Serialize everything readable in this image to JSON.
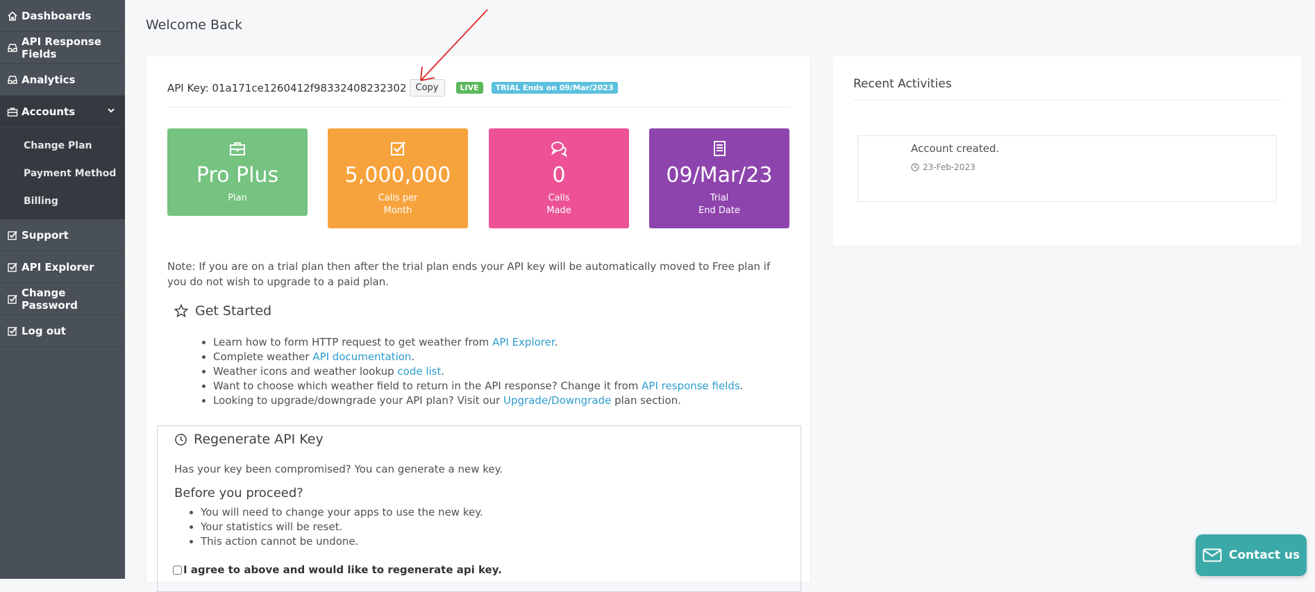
{
  "sidebar": {
    "items": [
      {
        "label": "Dashboards",
        "icon": "home-icon"
      },
      {
        "label": "API Response Fields",
        "icon": "inbox-icon"
      },
      {
        "label": "Analytics",
        "icon": "inbox-icon"
      },
      {
        "label": "Accounts",
        "icon": "briefcase-icon",
        "active": true
      }
    ],
    "subitems": [
      "Change Plan",
      "Payment Method",
      "Billing"
    ],
    "items_after": [
      {
        "label": "Support",
        "icon": "checkbox-icon"
      },
      {
        "label": "API Explorer",
        "icon": "checkbox-icon"
      },
      {
        "label": "Change Password",
        "icon": "checkbox-icon"
      },
      {
        "label": "Log out",
        "icon": "checkbox-icon"
      }
    ]
  },
  "page_title": "Welcome Back",
  "api": {
    "key_text": "API Key: 01a171ce1260412f98332408232302",
    "copy_label": "Copy",
    "live_badge": "LIVE",
    "trial_badge": "TRIAL Ends on 09/Mar/2023"
  },
  "stats": [
    {
      "value": "Pro Plus",
      "label": "Plan",
      "color": "#75c281",
      "icon": "briefcase-icon"
    },
    {
      "value": "5,000,000",
      "label": "Calls per\nMonth",
      "color": "#f7a33d",
      "icon": "checkbox-icon"
    },
    {
      "value": "0",
      "label": "Calls\nMade",
      "color": "#ec5295",
      "icon": "comments-icon"
    },
    {
      "value": "09/Mar/23",
      "label": "Trial\nEnd Date",
      "color": "#8e44ad",
      "icon": "document-icon"
    }
  ],
  "note": "Note: If you are on a trial plan then after the trial plan ends your API key will be automatically moved to Free plan if you do not wish to upgrade to a paid plan.",
  "get_started": {
    "title": "Get Started",
    "items": [
      {
        "before": "Learn how to form HTTP request to get weather from ",
        "link": "API Explorer",
        "after": "."
      },
      {
        "before": "Complete weather ",
        "link": "API documentation",
        "after": "."
      },
      {
        "before": "Weather icons and weather lookup ",
        "link": "code list",
        "after": "."
      },
      {
        "before": "Want to choose which weather field to return in the API response? Change it from ",
        "link": "API response fields",
        "after": "."
      },
      {
        "before": "Looking to upgrade/downgrade your API plan? Visit our ",
        "link": "Upgrade/Downgrade",
        "after": " plan section."
      }
    ]
  },
  "regenerate": {
    "title": "Regenerate API Key",
    "text": "Has your key been compromised? You can generate a new key.",
    "subtitle": "Before you proceed?",
    "items": [
      "You will need to change your apps to use the new key.",
      "Your statistics will be reset.",
      "This action cannot be undone."
    ],
    "agree_label": "I agree to above and would like to regenerate api key."
  },
  "activities": {
    "title": "Recent Activities",
    "items": [
      {
        "text": "Account created.",
        "date": "23-Feb-2023"
      }
    ]
  },
  "contact_label": "Contact us"
}
